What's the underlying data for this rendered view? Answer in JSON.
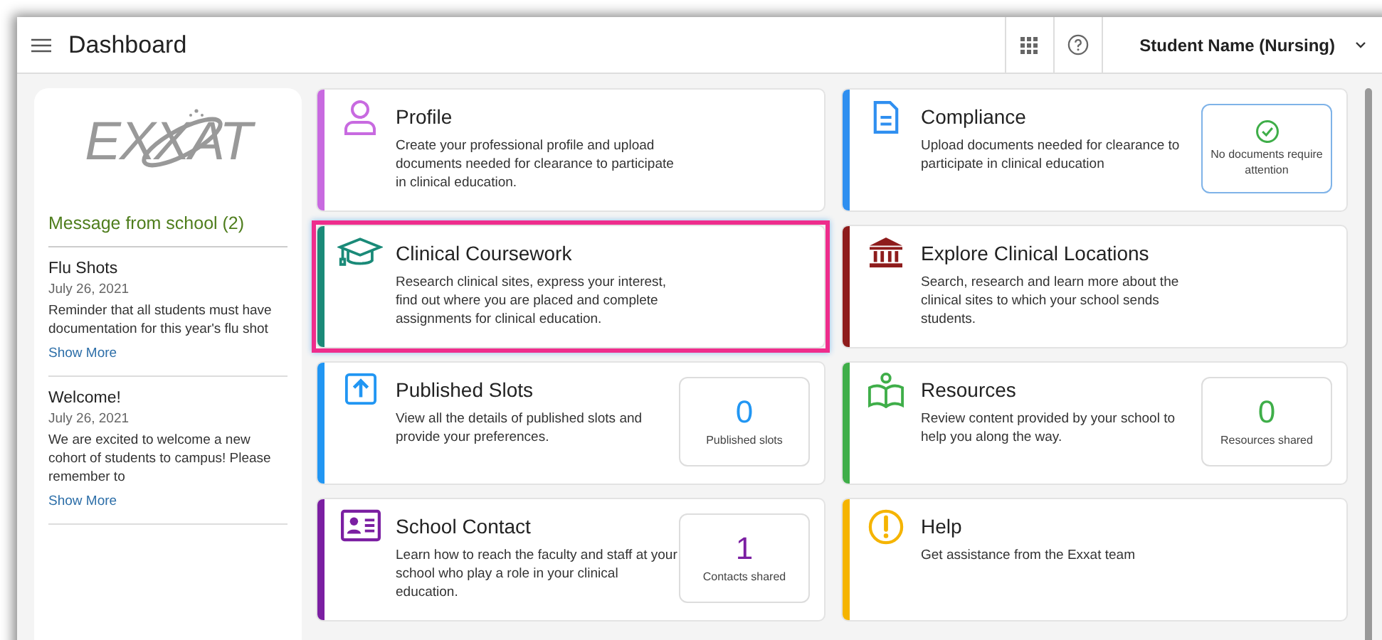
{
  "header": {
    "title": "Dashboard",
    "user": "Student Name (Nursing)"
  },
  "sidebar": {
    "logo": "EXXAT",
    "heading": "Message from school (2)",
    "messages": [
      {
        "title": "Flu Shots",
        "date": "July 26, 2021",
        "body": "Reminder that all students must have documentation for this year's flu shot",
        "link": "Show More"
      },
      {
        "title": "Welcome!",
        "date": "July 26, 2021",
        "body": "We are excited to welcome a new cohort of students to campus! Please remember to",
        "link": "Show More"
      }
    ]
  },
  "cards": [
    {
      "kind": "person",
      "title": "Profile",
      "description": "Create your professional profile and upload documents needed for clearance to participate in clinical education.",
      "color": "#c86ae0",
      "selected": false
    },
    {
      "kind": "document",
      "title": "Compliance",
      "description": "Upload documents needed for clearance to participate in clinical education",
      "color": "#2f8ff0",
      "selected": false,
      "stat": {
        "kind": "status",
        "label": "No documents require attention"
      }
    },
    {
      "kind": "cap",
      "title": "Clinical Coursework",
      "description": "Research clinical sites, express your interest, find out where you are placed and complete assignments for clinical education.",
      "color": "#1a8a78",
      "selected": true
    },
    {
      "kind": "building",
      "title": "Explore Clinical Locations",
      "description": "Search, research and learn more about the clinical sites to which your school sends students.",
      "color": "#8e1c1c",
      "selected": false
    },
    {
      "kind": "upload",
      "title": "Published Slots",
      "description": "View all the details of published slots and provide your preferences.",
      "color": "#2196f3",
      "selected": false,
      "stat": {
        "kind": "count",
        "value": "0",
        "label": "Published slots"
      }
    },
    {
      "kind": "book",
      "title": "Resources",
      "description": "Review content provided by your school to help you along the way.",
      "color": "#3fae49",
      "selected": false,
      "stat": {
        "kind": "count",
        "value": "0",
        "label": "Resources shared"
      }
    },
    {
      "kind": "contact",
      "title": "School Contact",
      "description": "Learn how to reach the faculty and staff at your school who play a role in your clinical education.",
      "color": "#7b1fa2",
      "selected": false,
      "stat": {
        "kind": "count",
        "value": "1",
        "label": "Contacts shared"
      }
    },
    {
      "kind": "alert",
      "title": "Help",
      "description": "Get assistance from the Exxat team",
      "color": "#f5b400",
      "selected": false
    }
  ]
}
